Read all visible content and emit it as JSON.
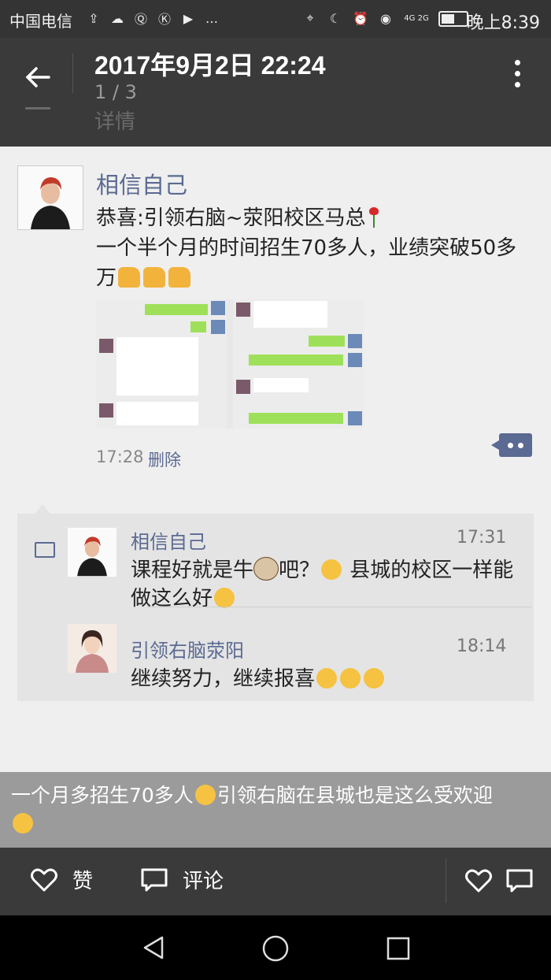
{
  "status_bar": {
    "carrier": "中国电信",
    "time": "晚上8:39",
    "network": "4G 2G"
  },
  "header": {
    "title": "2017年9月2日 22:24",
    "page_indicator": "1 / 3",
    "ghost_title": "详情"
  },
  "post": {
    "author": "相信自己",
    "line1": "恭喜:引领右脑~荥阳校区马总",
    "line2": "一个半个月的时间招生70多人，业绩突破50多万",
    "time": "17:28",
    "delete_label": "删除"
  },
  "comments": [
    {
      "name": "相信自己",
      "time": "17:31",
      "text_part1": "课程好就是牛",
      "text_part2": "吧？",
      "text_part3": " 县城的校区一样能做这么好"
    },
    {
      "name": "引领右脑荥阳",
      "time": "18:14",
      "text": "继续努力，继续报喜"
    }
  ],
  "caption": {
    "text_part1": "一个月多招生70多人",
    "text_part2": "引领右脑在县城也是这么受欢迎"
  },
  "bottom_bar": {
    "like_label": "赞",
    "comment_label": "评论"
  },
  "colors": {
    "link_blue": "#5b6a92",
    "header_bg": "#3a3a3a",
    "chat_green": "#9fe05a"
  }
}
